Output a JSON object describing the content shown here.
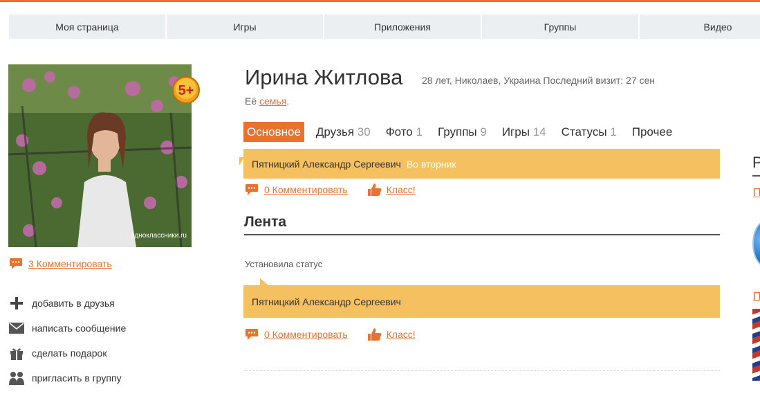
{
  "nav": [
    "Моя страница",
    "Игры",
    "Приложения",
    "Группы",
    "Видео"
  ],
  "profile": {
    "name": "Ирина Житлова",
    "meta": "28 лет, Николаев, Украина  Последний визит: 27 сен",
    "family_prefix": "Её ",
    "family_link": "семья",
    "family_suffix": ".",
    "photo_watermark": "одноклассники.ru",
    "badge": "5+",
    "photo_comments": "3 Комментировать"
  },
  "actions": [
    {
      "label": "добавить в друзья",
      "icon": "plus-icon"
    },
    {
      "label": "написать сообщение",
      "icon": "envelope-icon"
    },
    {
      "label": "сделать подарок",
      "icon": "gift-icon"
    },
    {
      "label": "пригласить в группу",
      "icon": "group-icon"
    }
  ],
  "tabs": [
    {
      "label": "Основное",
      "count": ""
    },
    {
      "label": "Друзья",
      "count": "30"
    },
    {
      "label": "Фото",
      "count": "1"
    },
    {
      "label": "Группы",
      "count": "9"
    },
    {
      "label": "Игры",
      "count": "14"
    },
    {
      "label": "Статусы",
      "count": "1"
    },
    {
      "label": "Прочее",
      "count": ""
    }
  ],
  "status_top": {
    "author": "Пятницкий Александр Сергеевич",
    "when": "Во вторник",
    "comment": "0 Комментировать",
    "like": "Класс!"
  },
  "feed": {
    "title": "Лента",
    "event": "Установила статус",
    "author": "Пятницкий Александр Сергеевич",
    "comment": "0 Комментировать",
    "like": "Класс!"
  },
  "right": {
    "heading_fragment": "Р",
    "link1_fragment": "П",
    "link2_fragment": "П"
  },
  "colors": {
    "accent": "#eb722e",
    "status_bg": "#f4c060",
    "nav_bg": "#eceff2"
  }
}
